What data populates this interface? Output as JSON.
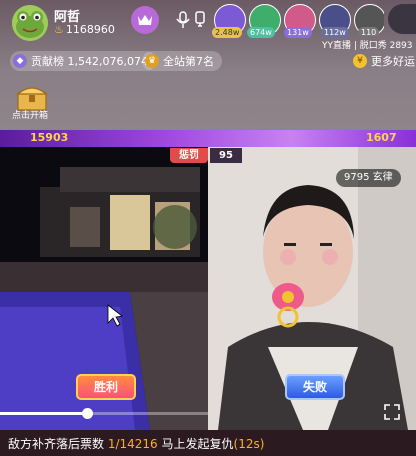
{
  "host": {
    "name": "阿哲",
    "id": "1168960"
  },
  "viewers": [
    {
      "badge": "2.48w",
      "bg": "#7c5ad6",
      "face": "#eee"
    },
    {
      "badge": "674w",
      "bg": "#3fae6a",
      "face": "#6fbf5a"
    },
    {
      "badge": "131w",
      "bg": "#d05a8a",
      "face": "#e9c8b3"
    },
    {
      "badge": "112w",
      "bg": "#4a4f8a",
      "face": "#2b2f44"
    },
    {
      "badge": "110",
      "bg": "#555",
      "face": "#3a3a3a"
    }
  ],
  "yy_info": "YY直播 | 脱口秀 2893",
  "row2": {
    "contribution_label": "贡献榜 1,542,076,074",
    "rank_label": "全站第7名",
    "more_label": "更多好运"
  },
  "chest_label": "点击开箱",
  "pk": {
    "left_score": "15903",
    "right_score": "1607",
    "punish_label": "惩罚",
    "punish_count": "95",
    "guest_name": "9795 玄律",
    "win_label": "胜利",
    "lose_label": "失败",
    "progress": 0.42
  },
  "bottom": {
    "prefix": "敌方补齐落后票数 ",
    "count": "1/14216",
    "middle": " 马上发起复仇",
    "timer": "(12s)"
  }
}
